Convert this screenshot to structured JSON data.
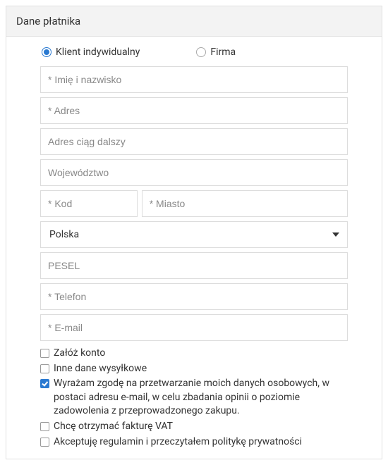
{
  "panel": {
    "title": "Dane płatnika"
  },
  "customer_type": {
    "individual": "Klient indywidualny",
    "company": "Firma",
    "selected": "individual"
  },
  "fields": {
    "name": {
      "placeholder": "* Imię i nazwisko",
      "value": ""
    },
    "address": {
      "placeholder": "* Adres",
      "value": ""
    },
    "address2": {
      "placeholder": "Adres ciąg dalszy",
      "value": ""
    },
    "region": {
      "placeholder": "Województwo",
      "value": ""
    },
    "zip": {
      "placeholder": "* Kod",
      "value": ""
    },
    "city": {
      "placeholder": "* Miasto",
      "value": ""
    },
    "country": {
      "selected": "Polska"
    },
    "pesel": {
      "placeholder": "PESEL",
      "value": ""
    },
    "phone": {
      "placeholder": "* Telefon",
      "value": ""
    },
    "email": {
      "placeholder": "* E-mail",
      "value": ""
    }
  },
  "checks": {
    "create_account": {
      "label": "Załóż konto",
      "checked": false
    },
    "diff_shipping": {
      "label": "Inne dane wysyłkowe",
      "checked": false
    },
    "marketing_consent": {
      "label": "Wyrażam zgodę na przetwarzanie moich danych osobowych, w postaci adresu e-mail, w celu zbadania opinii o poziomie zadowolenia z przeprowadzonego zakupu.",
      "checked": true
    },
    "vat_invoice": {
      "label": "Chcę otrzymać fakturę VAT",
      "checked": false
    },
    "terms": {
      "label": "Akceptuję regulamin i przeczytałem politykę prywatności",
      "checked": false
    }
  }
}
